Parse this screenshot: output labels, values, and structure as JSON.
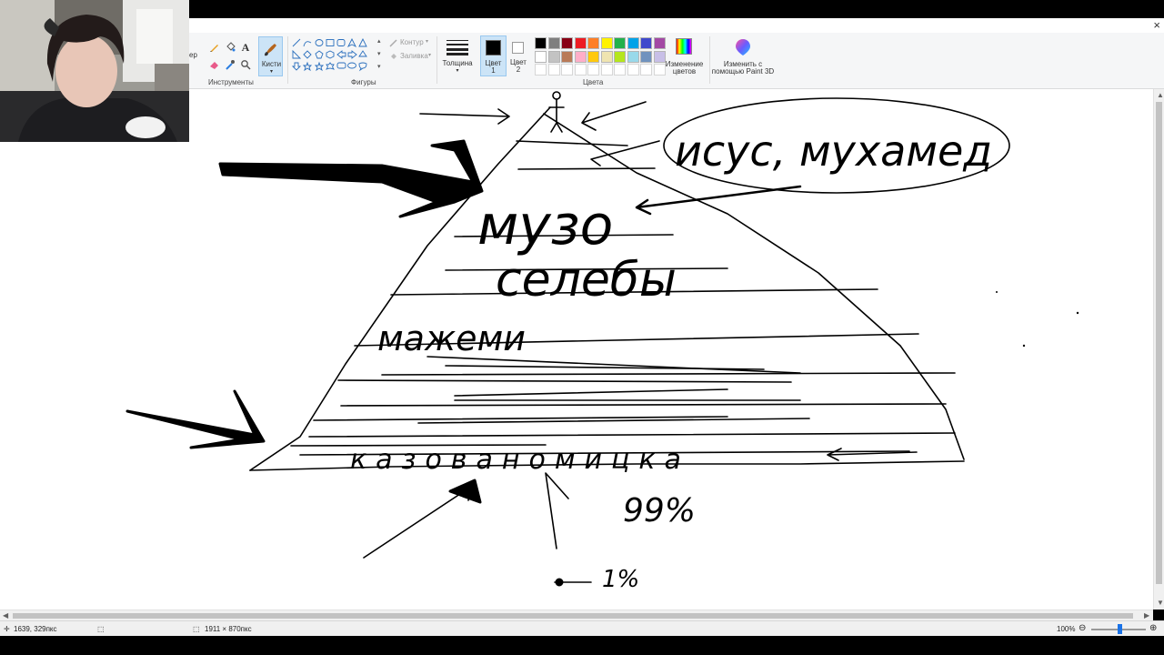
{
  "window": {
    "close_glyph": "×",
    "partial_left_label": "ер"
  },
  "ribbon": {
    "groups": {
      "tools": "Инструменты",
      "shapes": "Фигуры",
      "colors": "Цвета"
    },
    "brushes_label": "Кисти",
    "outline_label": "Контур",
    "fill_label": "Заливка",
    "thickness_label": "Толщина",
    "color1_label": "Цвет\n1",
    "color1_line1": "Цвет",
    "color1_line2": "1",
    "color2_line1": "Цвет",
    "color2_line2": "2",
    "edit_colors_line1": "Изменение",
    "edit_colors_line2": "цветов",
    "paint3d_line1": "Изменить с",
    "paint3d_line2": "помощью Paint 3D",
    "palette_row1": [
      "#000000",
      "#7f7f7f",
      "#880015",
      "#ed1c24",
      "#ff7f27",
      "#fff200",
      "#22b14c",
      "#00a2e8",
      "#3f48cc",
      "#a349a4"
    ],
    "palette_row2": [
      "#ffffff",
      "#c3c3c3",
      "#b97a57",
      "#ffaec9",
      "#ffc90e",
      "#efe4b0",
      "#b5e61d",
      "#99d9ea",
      "#7092be",
      "#c8bfe7"
    ],
    "color1": "#000000",
    "color2": "#ffffff",
    "icons": [
      "pencil-icon",
      "fill-icon",
      "text-icon",
      "eraser-icon",
      "picker-icon",
      "magnifier-icon"
    ]
  },
  "canvas": {
    "handwriting": {
      "top_label": "исус, мухамед",
      "level2": "музо",
      "level3": "селебы",
      "level4": "мажеми",
      "bottom": "казованомицка",
      "percent_99": "99%",
      "percent_1": "1%"
    }
  },
  "status": {
    "cursor_pos": "1639, 329пкс",
    "canvas_size": "1911 × 870пкс",
    "zoom": "100%"
  }
}
